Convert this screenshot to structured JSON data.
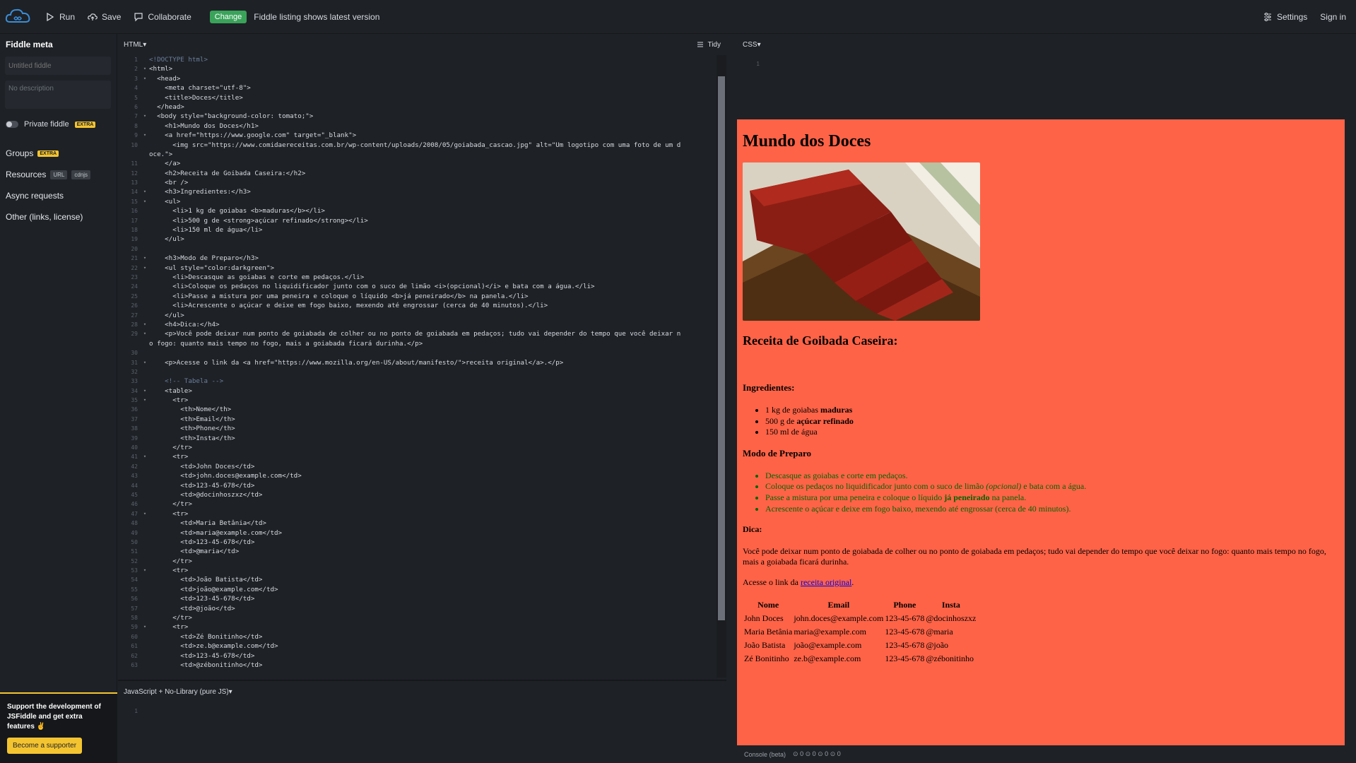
{
  "topbar": {
    "run": "Run",
    "save": "Save",
    "collaborate": "Collaborate",
    "change_badge": "Change",
    "notice": "Fiddle listing shows latest version",
    "settings": "Settings",
    "sign_in": "Sign in"
  },
  "sidebar": {
    "title": "Fiddle meta",
    "title_placeholder": "Untitled fiddle",
    "desc_placeholder": "No description",
    "private_label": "Private fiddle",
    "extra": "EXTRA",
    "groups": "Groups",
    "resources": "Resources",
    "url_pill": "URL",
    "cdnjs_pill": "cdnjs",
    "async": "Async requests",
    "other": "Other (links, license)",
    "support_text": "Support the development of JSFiddle and get extra features ✌",
    "supporter_button": "Become a supporter"
  },
  "html_panel": {
    "lang": "HTML",
    "tidy": "Tidy",
    "lines": [
      {
        "n": "1",
        "t": "<!DOCTYPE html>"
      },
      {
        "n": "2",
        "t": "<html>"
      },
      {
        "n": "3",
        "t": "  <head>"
      },
      {
        "n": "4",
        "t": "    <meta charset=\"utf-8\">"
      },
      {
        "n": "5",
        "t": "    <title>Doces</title>"
      },
      {
        "n": "6",
        "t": "  </head>"
      },
      {
        "n": "7",
        "t": "  <body style=\"background-color: tomato;\">"
      },
      {
        "n": "8",
        "t": "    <h1>Mundo dos Doces</h1>"
      },
      {
        "n": "9",
        "t": "    <a href=\"https://www.google.com\" target=\"_blank\">"
      },
      {
        "n": "10",
        "t": "      <img src=\"https://www.comidaereceitas.com.br/wp-content/uploads/2008/05/goiabada_cascao.jpg\" alt=\"Um logotipo com uma foto de um d"
      },
      {
        "n": "",
        "t": "oce.\">"
      },
      {
        "n": "11",
        "t": "    </a>"
      },
      {
        "n": "12",
        "t": "    <h2>Receita de Goibada Caseira:</h2>"
      },
      {
        "n": "13",
        "t": "    <br />"
      },
      {
        "n": "14",
        "t": "    <h3>Ingredientes:</h3>"
      },
      {
        "n": "15",
        "t": "    <ul>"
      },
      {
        "n": "16",
        "t": "      <li>1 kg de goiabas <b>maduras</b></li>"
      },
      {
        "n": "17",
        "t": "      <li>500 g de <strong>açúcar refinado</strong></li>"
      },
      {
        "n": "18",
        "t": "      <li>150 ml de água</li>"
      },
      {
        "n": "19",
        "t": "    </ul>"
      },
      {
        "n": "20",
        "t": ""
      },
      {
        "n": "21",
        "t": "    <h3>Modo de Preparo</h3>"
      },
      {
        "n": "22",
        "t": "    <ul style=\"color:darkgreen\">"
      },
      {
        "n": "23",
        "t": "      <li>Descasque as goiabas e corte em pedaços.</li>"
      },
      {
        "n": "24",
        "t": "      <li>Coloque os pedaços no liquidificador junto com o suco de limão <i>(opcional)</i> e bata com a água.</li>"
      },
      {
        "n": "25",
        "t": "      <li>Passe a mistura por uma peneira e coloque o líquido <b>já peneirado</b> na panela.</li>"
      },
      {
        "n": "26",
        "t": "      <li>Acrescente o açúcar e deixe em fogo baixo, mexendo até engrossar (cerca de 40 minutos).</li>"
      },
      {
        "n": "27",
        "t": "    </ul>"
      },
      {
        "n": "28",
        "t": "    <h4>Dica:</h4>"
      },
      {
        "n": "29",
        "t": "    <p>Você pode deixar num ponto de goiabada de colher ou no ponto de goiabada em pedaços; tudo vai depender do tempo que você deixar n"
      },
      {
        "n": "",
        "t": "o fogo: quanto mais tempo no fogo, mais a goiabada ficará durinha.</p>"
      },
      {
        "n": "30",
        "t": ""
      },
      {
        "n": "31",
        "t": "    <p>Acesse o link da <a href=\"https://www.mozilla.org/en-US/about/manifesto/\">receita original</a>.</p>"
      },
      {
        "n": "32",
        "t": ""
      },
      {
        "n": "33",
        "t": "    <!-- Tabela -->"
      },
      {
        "n": "34",
        "t": "    <table>"
      },
      {
        "n": "35",
        "t": "      <tr>"
      },
      {
        "n": "36",
        "t": "        <th>Nome</th>"
      },
      {
        "n": "37",
        "t": "        <th>Email</th>"
      },
      {
        "n": "38",
        "t": "        <th>Phone</th>"
      },
      {
        "n": "39",
        "t": "        <th>Insta</th>"
      },
      {
        "n": "40",
        "t": "      </tr>"
      },
      {
        "n": "41",
        "t": "      <tr>"
      },
      {
        "n": "42",
        "t": "        <td>John Doces</td>"
      },
      {
        "n": "43",
        "t": "        <td>john.doces@example.com</td>"
      },
      {
        "n": "44",
        "t": "        <td>123-45-678</td>"
      },
      {
        "n": "45",
        "t": "        <td>@docinhoszxz</td>"
      },
      {
        "n": "46",
        "t": "      </tr>"
      },
      {
        "n": "47",
        "t": "      <tr>"
      },
      {
        "n": "48",
        "t": "        <td>Maria Betânia</td>"
      },
      {
        "n": "49",
        "t": "        <td>maria@example.com</td>"
      },
      {
        "n": "50",
        "t": "        <td>123-45-678</td>"
      },
      {
        "n": "51",
        "t": "        <td>@maria</td>"
      },
      {
        "n": "52",
        "t": "      </tr>"
      },
      {
        "n": "53",
        "t": "      <tr>"
      },
      {
        "n": "54",
        "t": "        <td>João Batista</td>"
      },
      {
        "n": "55",
        "t": "        <td>joão@example.com</td>"
      },
      {
        "n": "56",
        "t": "        <td>123-45-678</td>"
      },
      {
        "n": "57",
        "t": "        <td>@joão</td>"
      },
      {
        "n": "58",
        "t": "      </tr>"
      },
      {
        "n": "59",
        "t": "      <tr>"
      },
      {
        "n": "60",
        "t": "        <td>Zé Bonitinho</td>"
      },
      {
        "n": "61",
        "t": "        <td>ze.b@example.com</td>"
      },
      {
        "n": "62",
        "t": "        <td>123-45-678</td>"
      },
      {
        "n": "63",
        "t": "        <td>@zébonitinho</td>"
      }
    ]
  },
  "js_panel": {
    "lang": "JavaScript + No-Library (pure JS)",
    "line": "1"
  },
  "css_panel": {
    "lang": "CSS",
    "line": "1"
  },
  "preview": {
    "h1": "Mundo dos Doces",
    "h2": "Receita de Goibada Caseira:",
    "ingredients_title": "Ingredientes:",
    "ingredients": [
      {
        "pre": "1 kg de goiabas ",
        "bold": "maduras",
        "post": ""
      },
      {
        "pre": "500 g de ",
        "bold": "açúcar refinado",
        "post": ""
      },
      {
        "pre": "150 ml de água",
        "bold": "",
        "post": ""
      }
    ],
    "prep_title": "Modo de Preparo",
    "prep_steps": [
      {
        "pre": "Descasque as goiabas e corte em pedaços.",
        "it": "",
        "post": ""
      },
      {
        "pre": "Coloque os pedaços no liquidificador junto com o suco de limão ",
        "it": "(opcional)",
        "post": " e bata com a água."
      },
      {
        "pre": "Passe a mistura por uma peneira e coloque o líquido ",
        "it": "já peneirado",
        "post": " na panela."
      },
      {
        "pre": "Acrescente o açúcar e deixe em fogo baixo, mexendo até engrossar (cerca de 40 minutos).",
        "it": "",
        "post": ""
      }
    ],
    "prep_color": "#006400",
    "tip_title": "Dica:",
    "tip": "Você pode deixar num ponto de goiabada de colher ou no ponto de goiabada em pedaços; tudo vai depender do tempo que você deixar no fogo: quanto mais tempo no fogo, mais a goiabada ficará durinha.",
    "link_pre": "Acesse o link da ",
    "link_text": "receita original",
    "link_post": ".",
    "table_headers": [
      "Nome",
      "Email",
      "Phone",
      "Insta"
    ],
    "table_rows": [
      [
        "John Doces",
        "john.doces@example.com",
        "123-45-678",
        "@docinhoszxz"
      ],
      [
        "Maria Betânia",
        "maria@example.com",
        "123-45-678",
        "@maria"
      ],
      [
        "João Batista",
        "joão@example.com",
        "123-45-678",
        "@joão"
      ],
      [
        "Zé Bonitinho",
        "ze.b@example.com",
        "123-45-678",
        "@zébonitinho"
      ]
    ],
    "bg_color": "#ff6347"
  },
  "console": {
    "label": "Console (beta)",
    "counts": [
      "0",
      "0",
      "0",
      "0"
    ]
  }
}
